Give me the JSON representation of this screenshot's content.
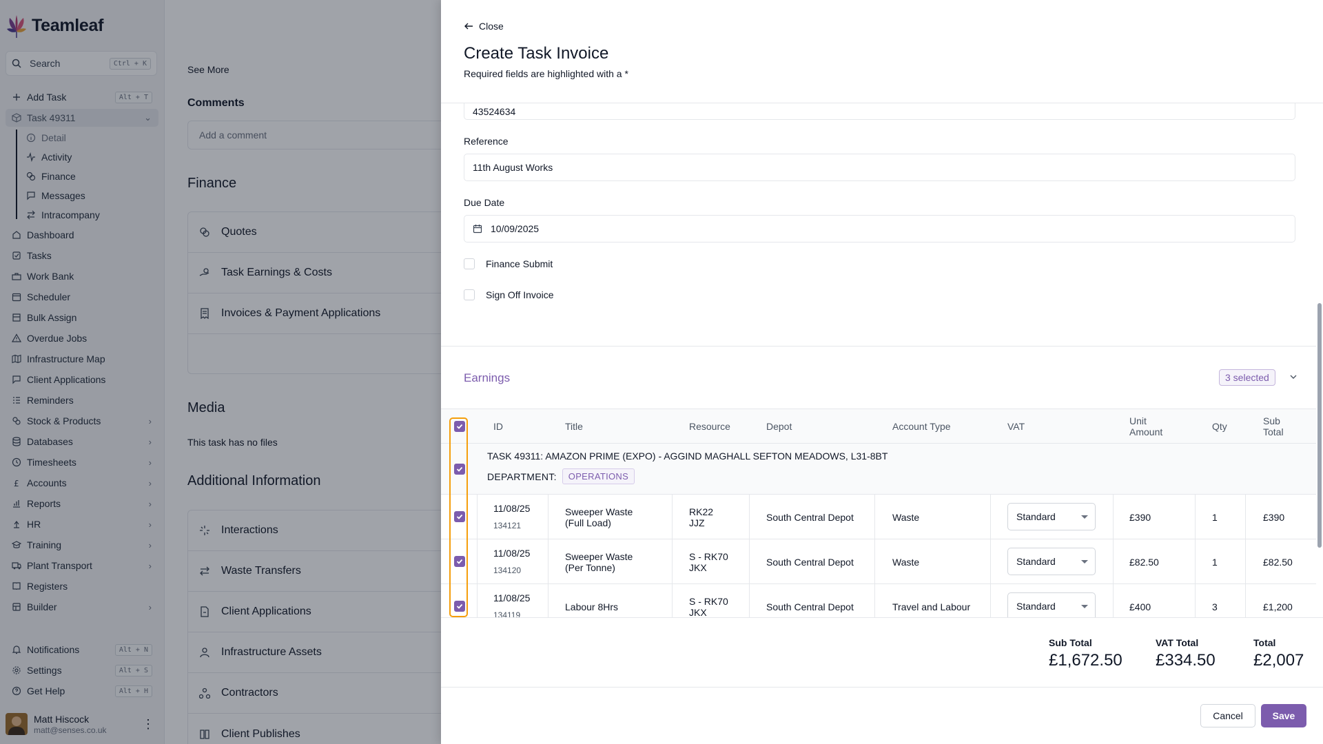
{
  "app": {
    "name": "Teamleaf"
  },
  "sidebar": {
    "search": {
      "label": "Search",
      "shortcut": "Ctrl + K"
    },
    "add_task": {
      "label": "Add Task",
      "shortcut": "Alt + T"
    },
    "current_task": "Task 49311",
    "task_sub": [
      "Detail",
      "Activity",
      "Finance",
      "Messages",
      "Intracompany"
    ],
    "nav": [
      "Dashboard",
      "Tasks",
      "Work Bank",
      "Scheduler",
      "Bulk Assign",
      "Overdue Jobs",
      "Infrastructure Map",
      "Client Applications",
      "Reminders",
      "Stock & Products",
      "Databases",
      "Timesheets",
      "Accounts",
      "Reports",
      "HR",
      "Training",
      "Plant Transport",
      "Registers",
      "Builder"
    ],
    "bottom": [
      {
        "label": "Notifications",
        "shortcut": "Alt + N"
      },
      {
        "label": "Settings",
        "shortcut": "Alt + S"
      },
      {
        "label": "Get Help",
        "shortcut": "Alt + H"
      }
    ],
    "user": {
      "name": "Matt Hiscock",
      "email": "matt@senses.co.uk"
    }
  },
  "main": {
    "see_more": "See More",
    "comments": "Comments",
    "comment_placeholder": "Add a comment",
    "finance": "Finance",
    "finance_items": [
      "Quotes",
      "Task Earnings & Costs",
      "Invoices & Payment Applications"
    ],
    "media": "Media",
    "no_files": "This task has no files",
    "additional": "Additional Information",
    "additional_items": [
      "Interactions",
      "Waste Transfers",
      "Client Applications",
      "Infrastructure Assets",
      "Contractors",
      "Client Publishes"
    ]
  },
  "drawer": {
    "close": "Close",
    "title": "Create Task Invoice",
    "subtitle": "Required fields are highlighted with a *",
    "partial_value": "43524634",
    "reference_label": "Reference",
    "reference_value": "11th August Works",
    "due_label": "Due Date",
    "due_value": "10/09/2025",
    "finance_submit": "Finance Submit",
    "sign_off": "Sign Off Invoice",
    "earnings": "Earnings",
    "selected": "3 selected",
    "columns": {
      "id": "ID",
      "title": "Title",
      "resource": "Resource",
      "depot": "Depot",
      "account": "Account Type",
      "vat": "VAT",
      "unit1": "Unit",
      "unit2": "Amount",
      "qty": "Qty",
      "sub1": "Sub",
      "sub2": "Total"
    },
    "group": {
      "title": "TASK 49311: AMAZON PRIME (EXPO) - AGGIND MAGHALL SEFTON MEADOWS, L31-8BT",
      "dept_label": "DEPARTMENT:",
      "dept": "OPERATIONS"
    },
    "rows": [
      {
        "date": "11/08/25",
        "id": "134121",
        "title1": "Sweeper Waste",
        "title2": "(Full Load)",
        "res1": "RK22",
        "res2": "JJZ",
        "depot": "South Central Depot",
        "account": "Waste",
        "vat": "Standard",
        "unit": "£390",
        "qty": "1",
        "sub": "£390"
      },
      {
        "date": "11/08/25",
        "id": "134120",
        "title1": "Sweeper Waste",
        "title2": "(Per Tonne)",
        "res1": "S - RK70",
        "res2": "JKX",
        "depot": "South Central Depot",
        "account": "Waste",
        "vat": "Standard",
        "unit": "£82.50",
        "qty": "1",
        "sub": "£82.50"
      },
      {
        "date": "11/08/25",
        "id": "134119",
        "title1": "Labour 8Hrs",
        "title2": "",
        "res1": "S - RK70",
        "res2": "JKX",
        "depot": "South Central Depot",
        "account": "Travel and Labour",
        "vat": "Standard",
        "unit": "£400",
        "qty": "3",
        "sub": "£1,200"
      }
    ],
    "totals": {
      "sub_label": "Sub Total",
      "sub": "£1,672.50",
      "vat_label": "VAT Total",
      "vat": "£334.50",
      "total_label": "Total",
      "total": "£2,007"
    },
    "cancel": "Cancel",
    "save": "Save"
  },
  "colors": {
    "accent": "#7c5cad",
    "highlight": "#f59e0b"
  }
}
